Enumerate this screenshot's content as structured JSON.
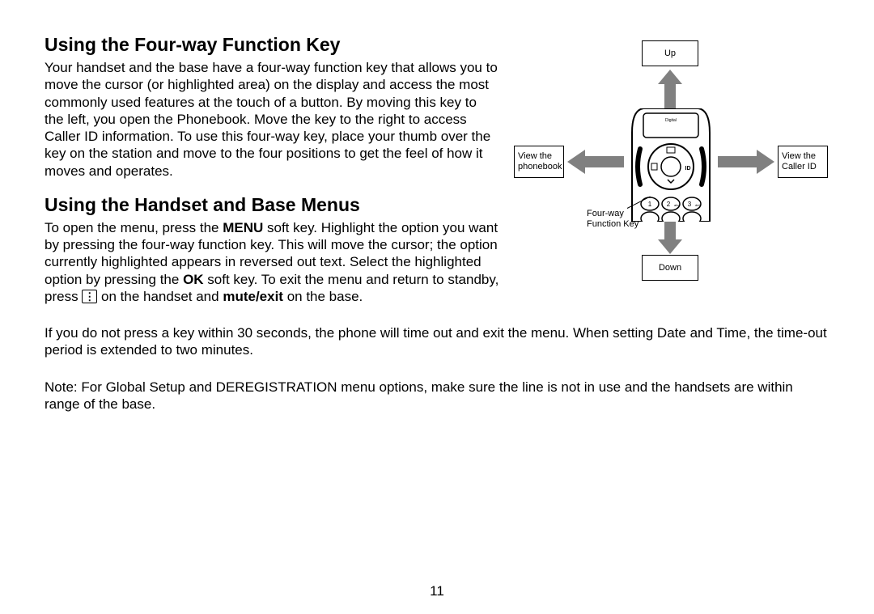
{
  "section1": {
    "heading": "Using the Four-way Function Key",
    "para": "Your handset and the base have a four-way function key that allows you to move the cursor (or highlighted area) on the display and access the most commonly used features at the touch of a button. By moving this key to the left, you open the Phonebook. Move the key to the right to access Caller ID information. To use this four-way key, place your thumb over the key on the station and move to the four positions to get the feel of how it moves and operates."
  },
  "section2": {
    "heading": "Using the Handset and Base Menus",
    "para_pre": "To open the menu, press the ",
    "menu": "MENU",
    "para_mid1": " soft key. Highlight the option you want by pressing the four-way function key. This will move the cursor; the option currently highlighted appears in reversed out text. Select the highlighted option by pressing the ",
    "ok": "OK",
    "para_mid2": " soft key. To exit the menu and return to standby, press ",
    "para_mid3": " on the handset and ",
    "mute": "mute/exit",
    "para_end": " on the base."
  },
  "para3": "If you do not press a key within 30 seconds, the phone will time out and exit the menu. When setting Date and Time, the time-out period is extended to two minutes.",
  "para4": "Note: For Global Setup and DEREGISTRATION menu options, make sure the line is not in use and the handsets are within range of the base.",
  "page": "11",
  "fig": {
    "up": "Up",
    "down": "Down",
    "left": "View the phonebook",
    "right": "View the Caller ID",
    "callout": "Four-way Function Key"
  }
}
